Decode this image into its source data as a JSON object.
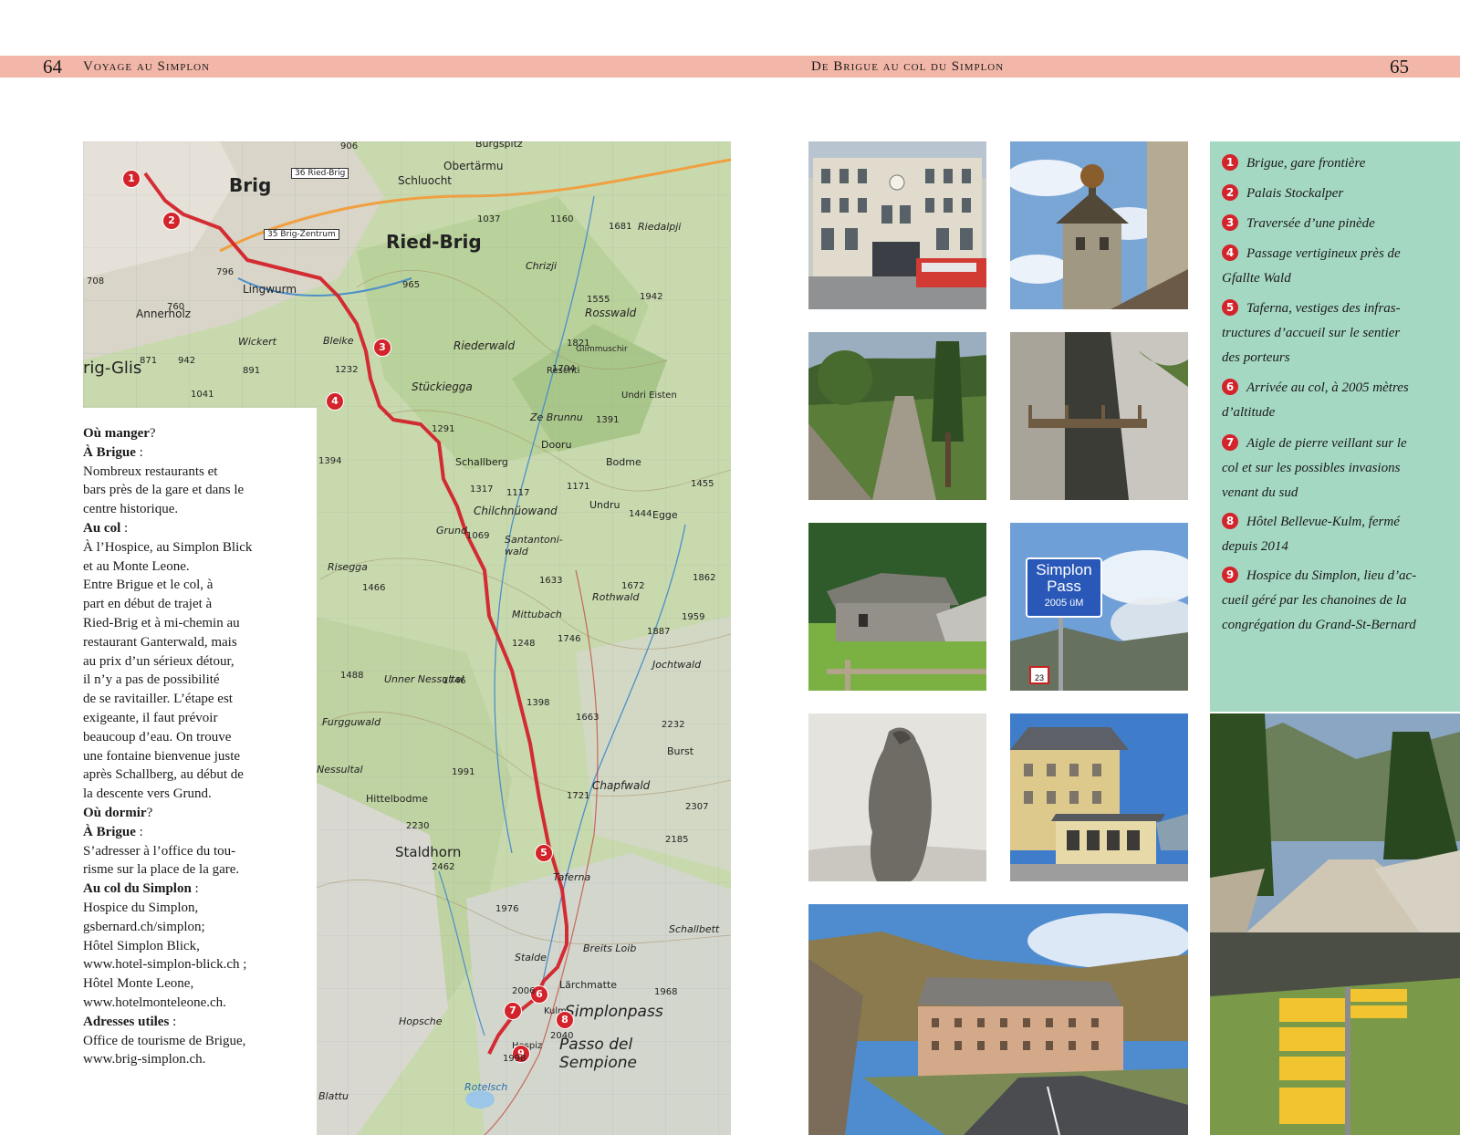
{
  "header": {
    "left_page_number": "64",
    "left_title": "Voyage au Simplon",
    "right_title": "De Brigue au col du Simplon",
    "right_page_number": "65"
  },
  "map": {
    "labels": [
      "Brig",
      "Ried-Brig",
      "Lingwurm",
      "Annerholz",
      "rig-Glis",
      "Schluocht",
      "Obertärmu",
      "Rosswald",
      "Riederwald",
      "Stückiegga",
      "Schallberg",
      "Chilchnüowand",
      "Santantoni-wald",
      "Grund",
      "Mittubach",
      "Rothwald",
      "Jochtwald",
      "Chapfwald",
      "Staldhorn",
      "Taferna",
      "Simplonpass",
      "Passo del Sempione",
      "Hospiz",
      "Kulm",
      "Lärchmatte",
      "Rotelsch",
      "Hopsche",
      "Bodme",
      "Dooru",
      "Egge",
      "Burst",
      "Hittelbodme",
      "Furgguwald",
      "Nessultal",
      "Unner Nessultal",
      "Risegga",
      "Bleike",
      "Wickert",
      "Stalde",
      "Breits Loib",
      "Schallbett",
      "Burgspitz",
      "Ze Brunnu",
      "Undri Eisten",
      "Reschti",
      "Chrizji",
      "Riedalpji",
      "Glimmuschir",
      "Undru",
      "Blattu"
    ],
    "signs": [
      "36 Ried-Brig",
      "35 Brig-Zentrum"
    ],
    "stage_markers": [
      "1",
      "2",
      "3",
      "4",
      "5",
      "6",
      "7",
      "8",
      "9"
    ],
    "elevation_labels": [
      "1232",
      "1291",
      "1069",
      "1248",
      "1398",
      "1663",
      "1721",
      "1991",
      "2230",
      "2462",
      "1976",
      "2006",
      "1998",
      "2040",
      "1968",
      "2185",
      "2307",
      "2232",
      "1746",
      "1887",
      "1959",
      "1672",
      "1633",
      "1444",
      "1455",
      "1171",
      "1117",
      "1317",
      "1391",
      "1704",
      "1821",
      "1555",
      "1942",
      "1681",
      "1160",
      "1037",
      "965",
      "906",
      "796",
      "708",
      "760",
      "871",
      "942",
      "891",
      "1041",
      "1394",
      "1466",
      "1488",
      "1746",
      "1862"
    ]
  },
  "info": {
    "heading1": "Où manger",
    "heading1_punct": "?",
    "sub1": "À Brigue",
    "sub1_punct": " :",
    "lines1": [
      "Nombreux restaurants et",
      "bars près de la gare et dans le",
      "centre historique."
    ],
    "sub2": "Au col",
    "sub2_punct": " :",
    "lines2": [
      "À l’Hospice, au Simplon Blick",
      "et au Monte Leone.",
      "Entre Brigue et le col, à",
      "part en début de trajet à",
      "Ried-Brig et à mi-chemin au",
      "restaurant Ganterwald, mais",
      "au prix d’un sérieux détour,",
      "il n’y a pas de possibilité",
      "de se ravitailler. L’étape est",
      "exigeante, il faut prévoir",
      "beaucoup d’eau. On trouve",
      "une fontaine bienvenue juste",
      "après Schallberg, au début de",
      "la descente vers Grund."
    ],
    "heading2": "Où dormir",
    "heading2_punct": "?",
    "sub3": "À Brigue",
    "sub3_punct": " :",
    "lines3": [
      "S’adresser à l’office du tou-",
      "risme sur la place de la gare."
    ],
    "sub4": "Au col du Simplon",
    "sub4_punct": " :",
    "lines4": [
      "Hospice du Simplon,",
      "gsbernard.ch/simplon;",
      "Hôtel Simplon Blick,",
      "www.hotel-simplon-blick.ch ;",
      "Hôtel Monte Leone,",
      "www.hotelmonteleone.ch."
    ],
    "sub5": "Adresses utiles",
    "sub5_punct": " :",
    "lines5": [
      "Office de tourisme de Brigue,",
      "www.brig-simplon.ch."
    ]
  },
  "photos": {
    "sign_line1": "Simplon",
    "sign_line2": "Pass",
    "sign_line3": "2005 üM",
    "road_sign": "23"
  },
  "legend": {
    "items": [
      {
        "num": "1",
        "lines": [
          "Brigue, gare frontière"
        ]
      },
      {
        "num": "2",
        "lines": [
          "Palais Stockalper"
        ]
      },
      {
        "num": "3",
        "lines": [
          "Traversée d’une pinède"
        ]
      },
      {
        "num": "4",
        "lines": [
          "Passage vertigineux près de",
          "Gfallte Wald"
        ]
      },
      {
        "num": "5",
        "lines": [
          "Taferna, vestiges des infras-",
          "tructures d’accueil sur le sentier",
          "des porteurs"
        ]
      },
      {
        "num": "6",
        "lines": [
          "Arrivée au col, à 2005 mètres",
          "d’altitude"
        ]
      },
      {
        "num": "7",
        "lines": [
          "Aigle de pierre veillant sur le",
          "col et sur les possibles invasions",
          "venant du sud"
        ]
      },
      {
        "num": "8",
        "lines": [
          "Hôtel Bellevue-Kulm, fermé",
          "depuis 2014"
        ]
      },
      {
        "num": "9",
        "lines": [
          "Hospice du Simplon, lieu d’ac-",
          "cueil géré par les chanoines de la",
          "congrégation du Grand-St-Bernard"
        ]
      }
    ]
  },
  "colors": {
    "header_band": "#f2b7a8",
    "legend_bg": "#a5d8c3",
    "route_red": "#d3232b"
  }
}
